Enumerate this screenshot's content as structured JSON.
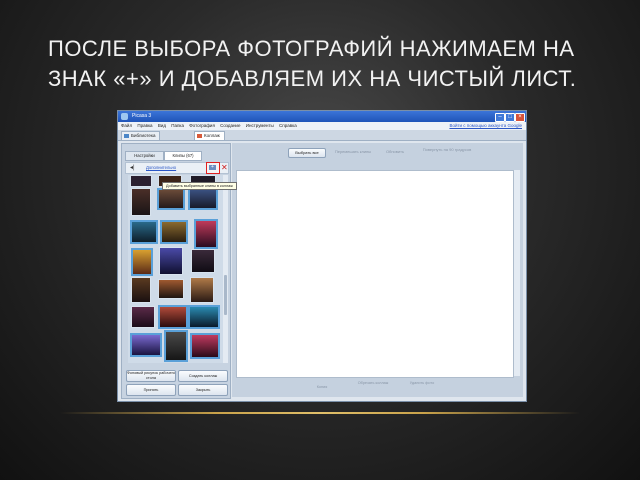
{
  "slide": {
    "title_line1": "ПОСЛЕ ВЫБОРА ФОТОГРАФИЙ НАЖИМАЕМ НА",
    "title_line2": "ЗНАК «+» И ДОБАВЛЯЕМ ИХ НА ЧИСТЫЙ ЛИСТ."
  },
  "window": {
    "title": "Picasa 3",
    "menu": [
      "Файл",
      "Правка",
      "Вид",
      "Папка",
      "Фотография",
      "Создание",
      "Инструменты",
      "Справка"
    ],
    "help_link": "Войти с помощью аккаунта Google",
    "tabs": [
      "Библиотека",
      "Коллаж"
    ]
  },
  "left_panel": {
    "tabs": [
      "Настройки",
      "Клипы (67)"
    ],
    "back_label": "◂|",
    "extra_label": "Дополнительно",
    "add_button_label": "+",
    "remove_label": "✕",
    "tooltip": "Добавить выбранные клипы в коллаж",
    "buttons": [
      {
        "label": "Фоновый рисунок рабочего стола"
      },
      {
        "label": "Создать коллаж"
      },
      {
        "label": "Принять"
      },
      {
        "label": "Закрыть"
      }
    ]
  },
  "right_panel": {
    "toolbar": [
      "Выбрать все",
      "Перемешать клипы",
      "Обновить",
      "Повернуть на 90 градусов"
    ],
    "bottom": [
      "Копия",
      "Обрезать коллаж",
      "Удалить фото"
    ]
  },
  "colors": {
    "title_text": "#f2f2f2",
    "accent_line": "#c9a24a",
    "highlight": "#e02020",
    "selection": "#5aa0d8"
  }
}
